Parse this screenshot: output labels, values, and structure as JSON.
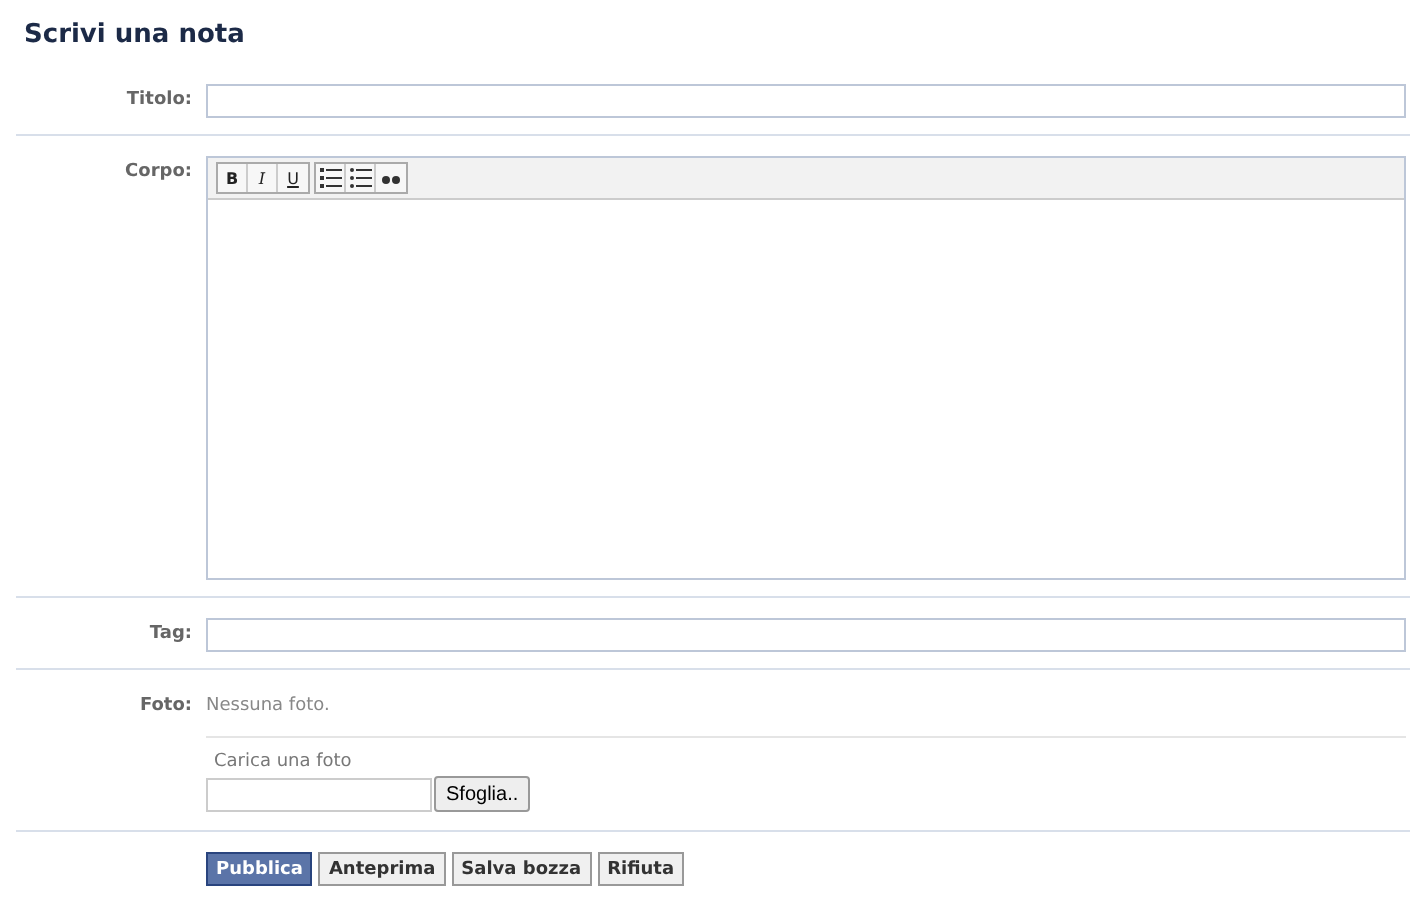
{
  "page": {
    "title": "Scrivi una nota"
  },
  "fields": [
    {
      "kind": "text",
      "label": "Titolo:"
    },
    {
      "kind": "editor",
      "label": "Corpo:",
      "toolbar": [
        {
          "kind": "bold",
          "label": "B"
        },
        {
          "kind": "italic",
          "label": "I"
        },
        {
          "kind": "underline",
          "label": "U"
        },
        {
          "kind": "ordered-list"
        },
        {
          "kind": "bullet-list"
        },
        {
          "kind": "quote"
        }
      ]
    },
    {
      "kind": "text",
      "label": "Tag:"
    },
    {
      "kind": "photo",
      "label": "Foto:",
      "status": "Nessuna foto.",
      "upload_label": "Carica una foto",
      "browse_button": "Sfoglia.."
    }
  ],
  "buttons": [
    {
      "label": "Pubblica",
      "kind": "primary"
    },
    {
      "label": "Anteprima",
      "kind": "normal"
    },
    {
      "label": "Salva bozza",
      "kind": "normal"
    },
    {
      "label": "Rifiuta",
      "kind": "normal"
    }
  ]
}
